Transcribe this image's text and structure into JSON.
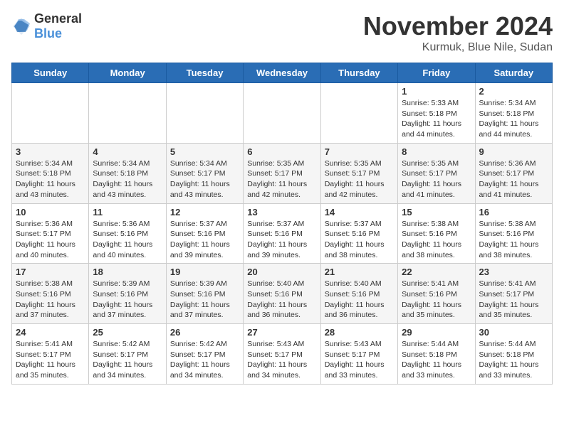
{
  "logo": {
    "general": "General",
    "blue": "Blue"
  },
  "title": "November 2024",
  "location": "Kurmuk, Blue Nile, Sudan",
  "days_of_week": [
    "Sunday",
    "Monday",
    "Tuesday",
    "Wednesday",
    "Thursday",
    "Friday",
    "Saturday"
  ],
  "weeks": [
    [
      {
        "day": "",
        "info": ""
      },
      {
        "day": "",
        "info": ""
      },
      {
        "day": "",
        "info": ""
      },
      {
        "day": "",
        "info": ""
      },
      {
        "day": "",
        "info": ""
      },
      {
        "day": "1",
        "info": "Sunrise: 5:33 AM\nSunset: 5:18 PM\nDaylight: 11 hours and 44 minutes."
      },
      {
        "day": "2",
        "info": "Sunrise: 5:34 AM\nSunset: 5:18 PM\nDaylight: 11 hours and 44 minutes."
      }
    ],
    [
      {
        "day": "3",
        "info": "Sunrise: 5:34 AM\nSunset: 5:18 PM\nDaylight: 11 hours and 43 minutes."
      },
      {
        "day": "4",
        "info": "Sunrise: 5:34 AM\nSunset: 5:18 PM\nDaylight: 11 hours and 43 minutes."
      },
      {
        "day": "5",
        "info": "Sunrise: 5:34 AM\nSunset: 5:17 PM\nDaylight: 11 hours and 43 minutes."
      },
      {
        "day": "6",
        "info": "Sunrise: 5:35 AM\nSunset: 5:17 PM\nDaylight: 11 hours and 42 minutes."
      },
      {
        "day": "7",
        "info": "Sunrise: 5:35 AM\nSunset: 5:17 PM\nDaylight: 11 hours and 42 minutes."
      },
      {
        "day": "8",
        "info": "Sunrise: 5:35 AM\nSunset: 5:17 PM\nDaylight: 11 hours and 41 minutes."
      },
      {
        "day": "9",
        "info": "Sunrise: 5:36 AM\nSunset: 5:17 PM\nDaylight: 11 hours and 41 minutes."
      }
    ],
    [
      {
        "day": "10",
        "info": "Sunrise: 5:36 AM\nSunset: 5:17 PM\nDaylight: 11 hours and 40 minutes."
      },
      {
        "day": "11",
        "info": "Sunrise: 5:36 AM\nSunset: 5:16 PM\nDaylight: 11 hours and 40 minutes."
      },
      {
        "day": "12",
        "info": "Sunrise: 5:37 AM\nSunset: 5:16 PM\nDaylight: 11 hours and 39 minutes."
      },
      {
        "day": "13",
        "info": "Sunrise: 5:37 AM\nSunset: 5:16 PM\nDaylight: 11 hours and 39 minutes."
      },
      {
        "day": "14",
        "info": "Sunrise: 5:37 AM\nSunset: 5:16 PM\nDaylight: 11 hours and 38 minutes."
      },
      {
        "day": "15",
        "info": "Sunrise: 5:38 AM\nSunset: 5:16 PM\nDaylight: 11 hours and 38 minutes."
      },
      {
        "day": "16",
        "info": "Sunrise: 5:38 AM\nSunset: 5:16 PM\nDaylight: 11 hours and 38 minutes."
      }
    ],
    [
      {
        "day": "17",
        "info": "Sunrise: 5:38 AM\nSunset: 5:16 PM\nDaylight: 11 hours and 37 minutes."
      },
      {
        "day": "18",
        "info": "Sunrise: 5:39 AM\nSunset: 5:16 PM\nDaylight: 11 hours and 37 minutes."
      },
      {
        "day": "19",
        "info": "Sunrise: 5:39 AM\nSunset: 5:16 PM\nDaylight: 11 hours and 37 minutes."
      },
      {
        "day": "20",
        "info": "Sunrise: 5:40 AM\nSunset: 5:16 PM\nDaylight: 11 hours and 36 minutes."
      },
      {
        "day": "21",
        "info": "Sunrise: 5:40 AM\nSunset: 5:16 PM\nDaylight: 11 hours and 36 minutes."
      },
      {
        "day": "22",
        "info": "Sunrise: 5:41 AM\nSunset: 5:16 PM\nDaylight: 11 hours and 35 minutes."
      },
      {
        "day": "23",
        "info": "Sunrise: 5:41 AM\nSunset: 5:17 PM\nDaylight: 11 hours and 35 minutes."
      }
    ],
    [
      {
        "day": "24",
        "info": "Sunrise: 5:41 AM\nSunset: 5:17 PM\nDaylight: 11 hours and 35 minutes."
      },
      {
        "day": "25",
        "info": "Sunrise: 5:42 AM\nSunset: 5:17 PM\nDaylight: 11 hours and 34 minutes."
      },
      {
        "day": "26",
        "info": "Sunrise: 5:42 AM\nSunset: 5:17 PM\nDaylight: 11 hours and 34 minutes."
      },
      {
        "day": "27",
        "info": "Sunrise: 5:43 AM\nSunset: 5:17 PM\nDaylight: 11 hours and 34 minutes."
      },
      {
        "day": "28",
        "info": "Sunrise: 5:43 AM\nSunset: 5:17 PM\nDaylight: 11 hours and 33 minutes."
      },
      {
        "day": "29",
        "info": "Sunrise: 5:44 AM\nSunset: 5:18 PM\nDaylight: 11 hours and 33 minutes."
      },
      {
        "day": "30",
        "info": "Sunrise: 5:44 AM\nSunset: 5:18 PM\nDaylight: 11 hours and 33 minutes."
      }
    ]
  ]
}
